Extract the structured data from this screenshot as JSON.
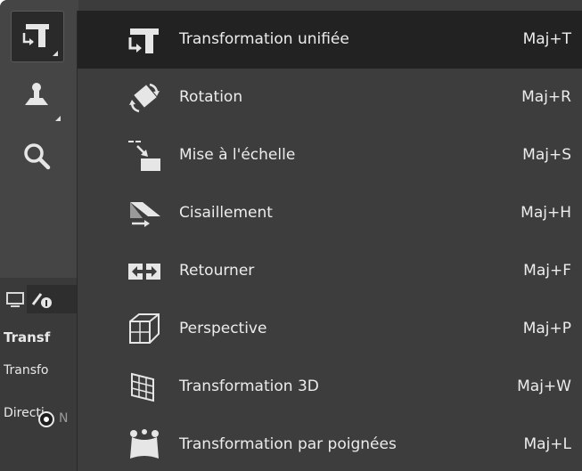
{
  "toolbox": {
    "tools": [
      {
        "icon": "unified-transform-icon",
        "active": true
      },
      {
        "icon": "clone-tool-icon",
        "active": false
      },
      {
        "icon": "magnify-icon",
        "active": false
      }
    ],
    "options": {
      "tabs": [
        {
          "icon": "device-status-icon"
        },
        {
          "icon": "tool-options-icon"
        }
      ],
      "title": "Transf",
      "transform_label": "Transfo",
      "direction_label": "Directi",
      "radio_label": "N"
    }
  },
  "menu": {
    "items": [
      {
        "label": "Transformation unifiée",
        "shortcut": "Maj+T",
        "icon": "unified-transform-icon",
        "highlighted": true
      },
      {
        "label": "Rotation",
        "shortcut": "Maj+R",
        "icon": "rotate-icon"
      },
      {
        "label": "Mise à l'échelle",
        "shortcut": "Maj+S",
        "icon": "scale-icon"
      },
      {
        "label": "Cisaillement",
        "shortcut": "Maj+H",
        "icon": "shear-icon"
      },
      {
        "label": "Retourner",
        "shortcut": "Maj+F",
        "icon": "flip-icon"
      },
      {
        "label": "Perspective",
        "shortcut": "Maj+P",
        "icon": "perspective-icon"
      },
      {
        "label": "Transformation 3D",
        "shortcut": "Maj+W",
        "icon": "transform-3d-icon"
      },
      {
        "label": "Transformation par poignées",
        "shortcut": "Maj+L",
        "icon": "handle-transform-icon"
      }
    ]
  },
  "colors": {
    "menu_bg": "#3d3d3d",
    "highlight_bg": "#222222",
    "text": "#ececec",
    "icon": "#e6e6e6"
  }
}
